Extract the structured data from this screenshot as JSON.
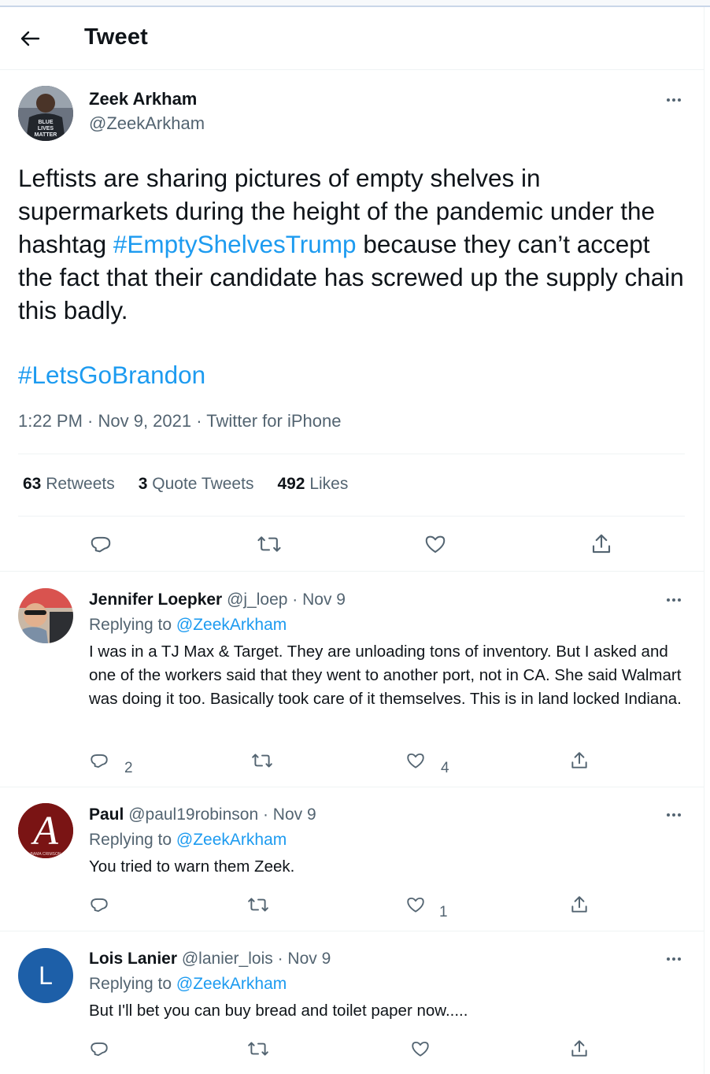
{
  "header": {
    "title": "Tweet"
  },
  "tweet": {
    "name": "Zeek Arkham",
    "handle": "@ZeekArkham",
    "avatar_text": [
      "BLUE",
      "LIVES",
      "MATTER"
    ],
    "text_part1": "Leftists are sharing pictures of empty shelves in supermarkets during the height of the pandemic under the hashtag ",
    "hashtag1": "#EmptyShelvesTrump",
    "text_part2": " because they can’t accept the fact that their candidate has screwed up the supply chain this badly.",
    "hashtag2": "#LetsGoBrandon",
    "meta": "1:22 PM · Nov 9, 2021 · Twitter for iPhone",
    "retweets_count": "63",
    "retweets_label": " Retweets",
    "quotes_count": "3",
    "quotes_label": " Quote Tweets",
    "likes_count": "492",
    "likes_label": " Likes"
  },
  "replies": [
    {
      "name": "Jennifer Loepker",
      "meta": " @j_loep · Nov 9",
      "replying_prefix": "Replying to ",
      "replying_handle": "@ZeekArkham",
      "text": "I was in a TJ Max & Target. They are unloading tons of inventory. But I asked and one of the workers said that they went to another port, not in CA. She said Walmart was doing it too. Basically took care of it themselves. This is in land locked Indiana.",
      "reply_count": "2",
      "retweet_count": "",
      "like_count": "4"
    },
    {
      "name": "Paul",
      "meta": " @paul19robinson · Nov 9",
      "replying_prefix": "Replying to ",
      "replying_handle": "@ZeekArkham",
      "text": "You tried to warn them Zeek.",
      "avatar_text": "A",
      "avatar_subtext": "BAMA CRIMSON",
      "reply_count": "",
      "retweet_count": "",
      "like_count": "1"
    },
    {
      "name": "Lois Lanier",
      "meta": " @lanier_lois · Nov 9",
      "replying_prefix": "Replying to ",
      "replying_handle": "@ZeekArkham",
      "text": "But I'll bet you can buy bread and toilet paper now.....",
      "avatar_text": "L",
      "reply_count": "",
      "retweet_count": "",
      "like_count": ""
    }
  ],
  "colors": {
    "accent": "#1d9bf0",
    "text": "#0f1419",
    "secondary": "#536471",
    "lois_avatar": "#1d5fa8",
    "paul_avatar": "#8b1a1a"
  },
  "icons": [
    "back-arrow-icon",
    "more-icon",
    "reply-icon",
    "retweet-icon",
    "like-icon",
    "share-icon"
  ]
}
